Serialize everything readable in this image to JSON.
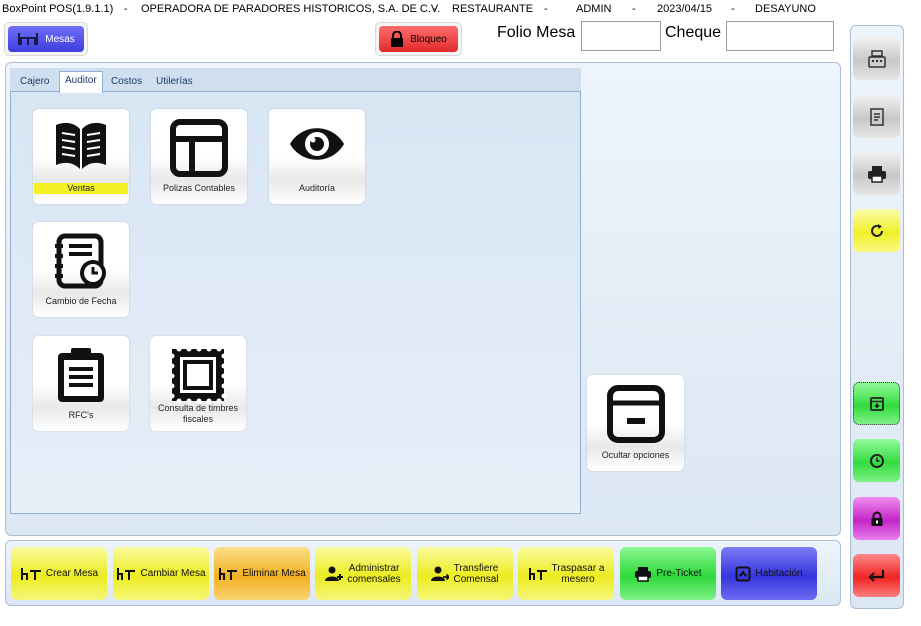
{
  "titlebar": {
    "app": "BoxPoint POS(1.9.1.1)",
    "company": "OPERADORA DE PARADORES HISTORICOS, S.A. DE C.V.",
    "area": "RESTAURANTE",
    "user": "ADMIN",
    "date": "2023/04/15",
    "meal": "DESAYUNO",
    "sep": "-"
  },
  "header": {
    "mesas_label": "Mesas",
    "bloqueo_label": "Bloqueo",
    "folio_label": "Folio Mesa",
    "folio_value": "",
    "cheque_label": "Cheque",
    "cheque_value": ""
  },
  "tabs": [
    {
      "label": "Cajero"
    },
    {
      "label": "Auditor"
    },
    {
      "label": "Costos"
    },
    {
      "label": "Utilerías"
    }
  ],
  "active_tab": "Auditor",
  "tiles": {
    "ventas": "Ventas",
    "polizas": "Polizas Contables",
    "auditoria": "Auditoría",
    "cambio_fecha": "Cambio de Fecha",
    "rfcs": "RFC's",
    "timbres_1": "Consulta de timbres",
    "timbres_2": "fiscales"
  },
  "ocultar_label": "Ocultar opciones",
  "bottom": {
    "crear_mesa": "Crear Mesa",
    "cambiar_mesa": "Cambiar Mesa",
    "eliminar_mesa": "Eliminar Mesa",
    "administrar_1": "Administrar",
    "administrar_2": "comensales",
    "transfiere_1": "Transfiere",
    "transfiere_2": "Comensal",
    "traspasar_1": "Traspasar a",
    "traspasar_2": "mesero",
    "pre_ticket": "Pre-Ticket",
    "habitacion": "Habitación"
  },
  "colors": {
    "highlight_yellow": "#f4f224",
    "yellow_button": "#ecec20",
    "green_button": "#2ed83a",
    "blue_button": "#3535dd",
    "red_button": "#ef2424",
    "magenta_button": "#c425c7",
    "orange_button": "#f2b022"
  },
  "icons": {
    "right_column": [
      "cash-register-icon",
      "receipt-icon",
      "printer-icon",
      "refresh-icon",
      "add-box-icon",
      "clock-icon",
      "lock-icon",
      "return-icon"
    ]
  }
}
